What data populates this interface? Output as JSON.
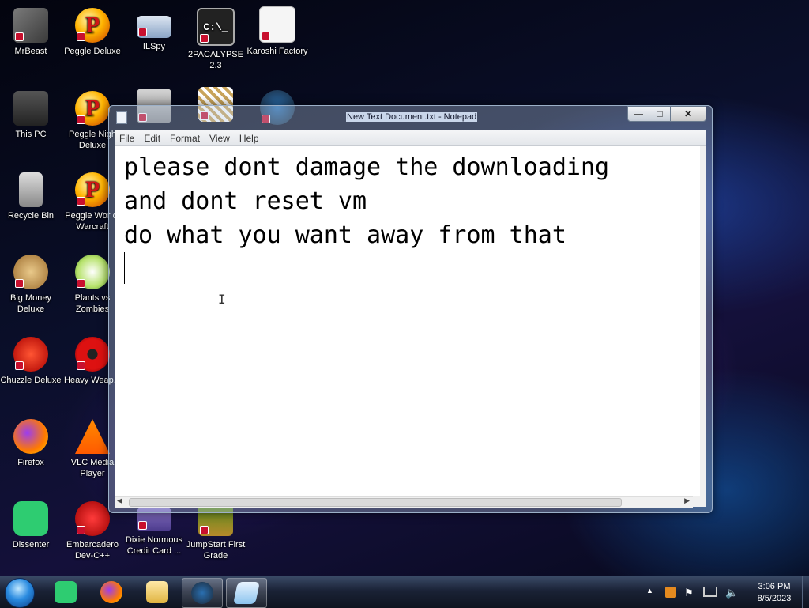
{
  "desktop": {
    "icons": [
      {
        "label": "MrBeast"
      },
      {
        "label": "Peggle Deluxe"
      },
      {
        "label": "ILSpy"
      },
      {
        "label": "2PACALYPSE 2.3"
      },
      {
        "label": "Karoshi Factory"
      },
      {
        "label": "This PC"
      },
      {
        "label": "Peggle Nights Deluxe",
        "shown": "Peggle Nigh Deluxe"
      },
      {
        "label": "Recycle Bin"
      },
      {
        "label": "Peggle World of Warcraft",
        "shown": "Peggle Wor of Warcraft"
      },
      {
        "label": "Big Money Deluxe"
      },
      {
        "label": "Plants vs Zombies",
        "shown": "Plants vs Zombies"
      },
      {
        "label": "Chuzzle Deluxe"
      },
      {
        "label": "Heavy Weap...",
        "shown": "Heavy Weap..."
      },
      {
        "label": "Firefox"
      },
      {
        "label": "VLC Media Player",
        "shown": "VLC Media Player"
      },
      {
        "label": "Dissenter"
      },
      {
        "label": "Embarcadero Dev-C++"
      },
      {
        "label": "Dixie Normous Credit Card ..."
      },
      {
        "label": "JumpStart First Grade"
      }
    ]
  },
  "notepad": {
    "title": "New Text Document.txt - Notepad",
    "buttons": {
      "minimize": "—",
      "maximize": "□",
      "close": "✕"
    },
    "menu": [
      "File",
      "Edit",
      "Format",
      "View",
      "Help"
    ],
    "lines": [
      "please dont damage the downloading",
      "and dont reset vm",
      "do what you want away from that"
    ],
    "cursor_glyph": "I"
  },
  "taskbar": {
    "pinned": [
      "Dissenter",
      "Firefox",
      "File Explorer",
      "Steam",
      "Notepad"
    ],
    "active": "Notepad",
    "clock": {
      "time": "3:06 PM",
      "date": "8/5/2023"
    },
    "tray_icons": [
      "show-hidden-icons",
      "orange-app-icon",
      "flag-icon",
      "network-icon",
      "volume-icon"
    ]
  }
}
